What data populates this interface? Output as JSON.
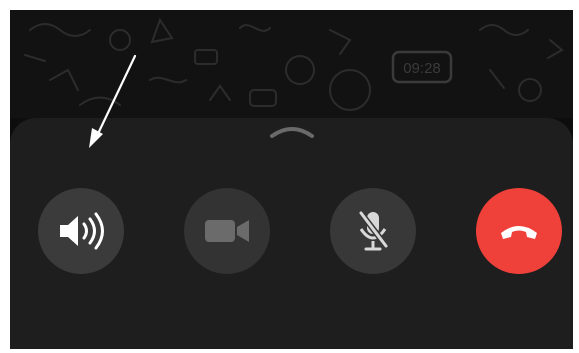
{
  "call_controls": {
    "speaker": {
      "icon": "speaker-icon"
    },
    "video": {
      "icon": "video-camera-icon"
    },
    "mute": {
      "icon": "microphone-muted-icon"
    },
    "end_call": {
      "icon": "phone-hangup-icon",
      "color": "#f0403a"
    }
  },
  "sheet": {
    "handle_icon": "chevron-up-icon"
  },
  "wallpaper": {
    "clock_doodle": "09:28"
  },
  "colors": {
    "background": "#0d0d0d",
    "sheet": "#1e1e1e",
    "button": "#3b3b3b",
    "end_call": "#f0403a",
    "annotation_arrow": "#ffffff"
  }
}
